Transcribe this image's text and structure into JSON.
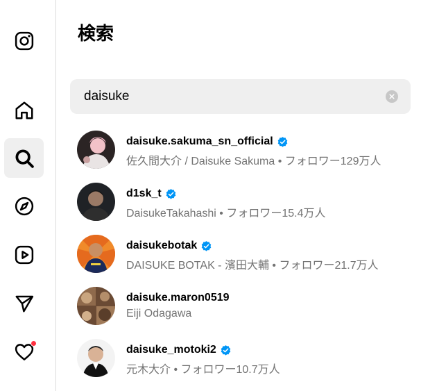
{
  "nav": {
    "items": [
      {
        "id": "logo",
        "icon": "instagram-logo-icon"
      },
      {
        "id": "home",
        "icon": "home-icon"
      },
      {
        "id": "search",
        "icon": "search-icon",
        "active": true
      },
      {
        "id": "explore",
        "icon": "compass-icon"
      },
      {
        "id": "reels",
        "icon": "reels-icon"
      },
      {
        "id": "messages",
        "icon": "send-icon"
      },
      {
        "id": "notifications",
        "icon": "heart-icon",
        "has_dot": true
      }
    ]
  },
  "panel": {
    "title": "検索"
  },
  "search": {
    "value": "daisuke"
  },
  "results": [
    {
      "username": "daisuke.sakuma_sn_official",
      "verified": true,
      "subtitle": "佐久間大介 / Daisuke Sakuma • フォロワー129万人",
      "avatar_color": "#c98a8a"
    },
    {
      "username": "d1sk_t",
      "verified": true,
      "subtitle": "DaisukeTakahashi • フォロワー15.4万人",
      "avatar_color": "#3a3a3a"
    },
    {
      "username": "daisukebotak",
      "verified": true,
      "subtitle": "DAISUKE BOTAK - 濱田大輔 • フォロワー21.7万人",
      "avatar_color": "#e8762a"
    },
    {
      "username": "daisuke.maron0519",
      "verified": false,
      "subtitle": "Eiji Odagawa",
      "avatar_color": "#8a6a4a"
    },
    {
      "username": "daisuke_motoki2",
      "verified": true,
      "subtitle": "元木大介 • フォロワー10.7万人",
      "avatar_color": "#d8d8d8"
    }
  ],
  "colors": {
    "verified": "#0095f6",
    "notification_dot": "#ff3040",
    "secondary_text": "#737373"
  }
}
